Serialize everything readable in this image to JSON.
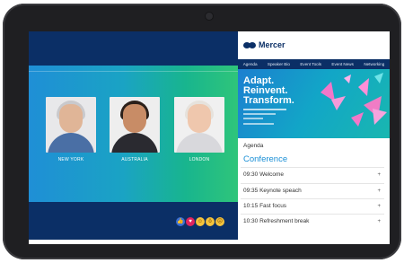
{
  "video": {
    "participants": [
      {
        "label": "NEW YORK"
      },
      {
        "label": "AUSTRALIA"
      },
      {
        "label": "LONDON"
      }
    ],
    "reactions": [
      "thumbs-up-icon",
      "heart-icon",
      "laugh-icon",
      "surprised-icon",
      "sad-icon"
    ]
  },
  "app": {
    "brand": "Mercer",
    "nav": [
      "Agenda",
      "Speaker Bio",
      "Event Tools",
      "Event News",
      "Networking"
    ],
    "hero": {
      "line1": "Adapt.",
      "line2": "Reinvent.",
      "line3": "Transform."
    },
    "agenda_label": "Agenda",
    "conference_title": "Conference",
    "items": [
      {
        "time_title": "09:30 Welcome",
        "action": "+"
      },
      {
        "time_title": "09:35 Keynote speach",
        "action": "+"
      },
      {
        "time_title": "10:15 Fast focus",
        "action": "+"
      },
      {
        "time_title": "10:30 Refreshment break",
        "action": "+"
      }
    ]
  },
  "colors": {
    "navy": "#0b2f66",
    "accent": "#1a8fd6",
    "butterfly": "#f277c9"
  }
}
